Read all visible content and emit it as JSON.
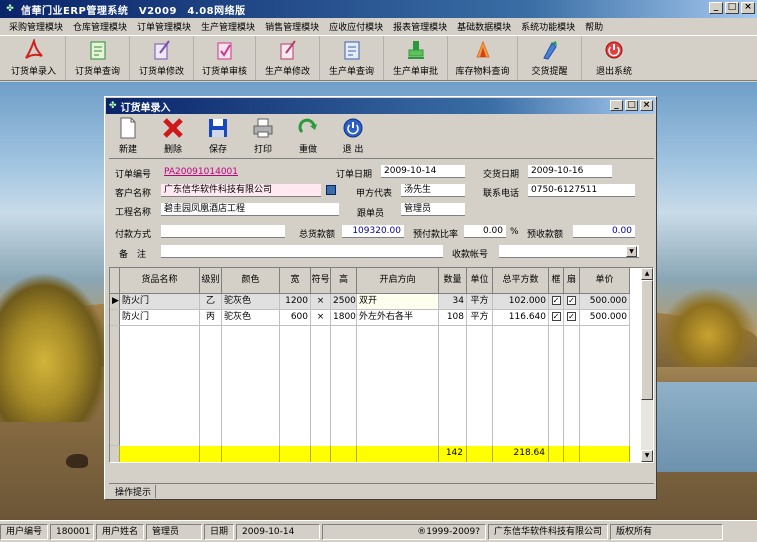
{
  "app": {
    "title": "信華门业ERP管理系统　V2009　4.08网络版",
    "controls": {
      "minimize": "_",
      "maximize": "□",
      "close": "×"
    }
  },
  "menu": [
    "采购管理模块",
    "仓库管理模块",
    "订单管理模块",
    "生产管理模块",
    "销售管理模块",
    "应收应付模块",
    "报表管理模块",
    "基础数据模块",
    "系统功能模块",
    "帮助"
  ],
  "toolbar": [
    {
      "label": "订货单录入",
      "icon": "acrobat-icon",
      "color": "#d02020"
    },
    {
      "label": "订货单查询",
      "icon": "ledger-icon",
      "color": "#2e8b3a"
    },
    {
      "label": "订货单修改",
      "icon": "quill-edit-icon",
      "color": "#7a4fb0"
    },
    {
      "label": "订货单审核",
      "icon": "check-icon",
      "color": "#c83a8a"
    },
    {
      "label": "生产单修改",
      "icon": "quill-edit-icon",
      "color": "#b04070"
    },
    {
      "label": "生产单查询",
      "icon": "ledger-icon",
      "color": "#4060b0"
    },
    {
      "label": "生产单审批",
      "icon": "stamp-icon",
      "color": "#2a9a3a"
    },
    {
      "label": "库存物料查询",
      "icon": "box-icon",
      "color": "#e07020"
    },
    {
      "label": "交货提醒",
      "icon": "bell-icon",
      "color": "#2050b0"
    },
    {
      "label": "退出系统",
      "icon": "power-icon",
      "color": "#c02020"
    }
  ],
  "window": {
    "title": "订货单录入",
    "toolbar": [
      {
        "label": "新建",
        "icon": "new-document-icon"
      },
      {
        "label": "删除",
        "icon": "delete-x-icon"
      },
      {
        "label": "保存",
        "icon": "save-disk-icon"
      },
      {
        "label": "打印",
        "icon": "printer-icon"
      },
      {
        "label": "重做",
        "icon": "redo-icon"
      },
      {
        "label": "退 出",
        "icon": "power-icon"
      }
    ],
    "form": {
      "order_no_label": "订单编号",
      "order_no": "PA20091014001",
      "order_date_label": "订单日期",
      "order_date": "2009-10-14",
      "delivery_date_label": "交货日期",
      "delivery_date": "2009-10-16",
      "customer_label": "客户名称",
      "customer": "广东信华软件科技有限公司",
      "rep_label": "甲方代表",
      "rep": "汤先生",
      "phone_label": "联系电话",
      "phone": "0750-6127511",
      "project_label": "工程名称",
      "project": "碧圭园凤凰酒店工程",
      "follower_label": "跟单员",
      "follower": "管理员",
      "payment_label": "付款方式",
      "payment": "",
      "total_label": "总货款额",
      "total": "109320.00",
      "prepay_ratio_label": "预付款比率",
      "prepay_ratio": "0.00",
      "percent": "%",
      "prepay_amount_label": "预收款额",
      "prepay_amount": "0.00",
      "note_label": "备　注",
      "note": "",
      "account_label": "收款帐号",
      "account": ""
    },
    "grid": {
      "columns": [
        "货品名称",
        "级别",
        "颜色",
        "宽",
        "符号",
        "高",
        "开启方向",
        "数量",
        "单位",
        "总平方数",
        "框",
        "扇",
        "单价"
      ],
      "rows": [
        {
          "name": "防火门",
          "grade": "乙",
          "color": "驼灰色",
          "width": "1200",
          "sym": "×",
          "height": "2500",
          "direction": "双开",
          "qty": "34",
          "unit": "平方",
          "area": "102.000",
          "frame": "✓",
          "leaf": "✓",
          "price": "500.000"
        },
        {
          "name": "防火门",
          "grade": "丙",
          "color": "驼灰色",
          "width": "600",
          "sym": "×",
          "height": "1800",
          "direction": "外左外右各半",
          "qty": "108",
          "unit": "平方",
          "area": "116.640",
          "frame": "✓",
          "leaf": "✓",
          "price": "500.000"
        }
      ],
      "totals": {
        "qty": "142",
        "area": "218.64"
      }
    },
    "tip": "操作提示"
  },
  "status": {
    "user_no_label": "用户编号",
    "user_no": "180001",
    "user_name_label": "用户姓名",
    "user_name": "管理员",
    "date_label": "日期",
    "date": "2009-10-14",
    "copyright": "®1999-2009?",
    "company": "广东信华软件科技有限公司",
    "rights": "版权所有"
  }
}
